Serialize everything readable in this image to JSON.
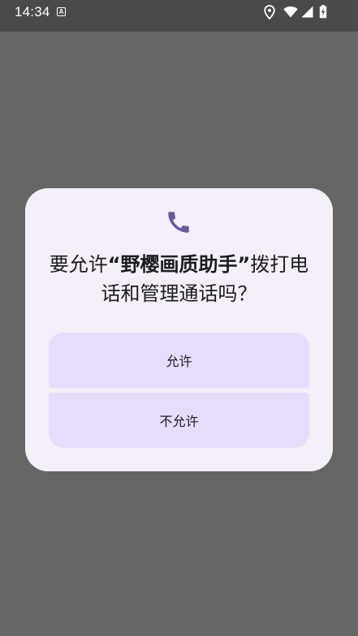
{
  "status_bar": {
    "time": "14:34",
    "notification_icon_letter": "A",
    "icons": [
      "location-icon",
      "wifi-icon",
      "signal-icon",
      "battery-charging-icon"
    ]
  },
  "dialog": {
    "icon": "phone-icon",
    "title_prefix": "要允许",
    "app_name": "“野樱画质助手”",
    "title_suffix": "拨打电话和管理通话吗？",
    "allow_label": "允许",
    "deny_label": "不允许"
  },
  "colors": {
    "scrim": "#666666",
    "status_bar": "#4a4a4a",
    "dialog_surface": "#f4eff8",
    "button_fill": "#e6ddfd",
    "icon_accent": "#6b5a9a"
  }
}
